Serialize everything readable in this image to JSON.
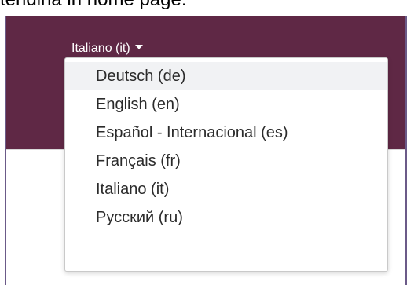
{
  "caption": "tendina in home page:",
  "colors": {
    "navbar": "#5f2845",
    "frame_border": "#6b5a88",
    "item_hover": "#f1f2f4"
  },
  "language_menu": {
    "current": "Italiano (it)",
    "toggle_icon": "caret-down-icon",
    "items": [
      {
        "label": "Deutsch (de)"
      },
      {
        "label": "English (en)"
      },
      {
        "label": "Español - Internacional (es)"
      },
      {
        "label": "Français (fr)"
      },
      {
        "label": "Italiano (it)"
      },
      {
        "label": "Русский (ru)"
      }
    ]
  }
}
